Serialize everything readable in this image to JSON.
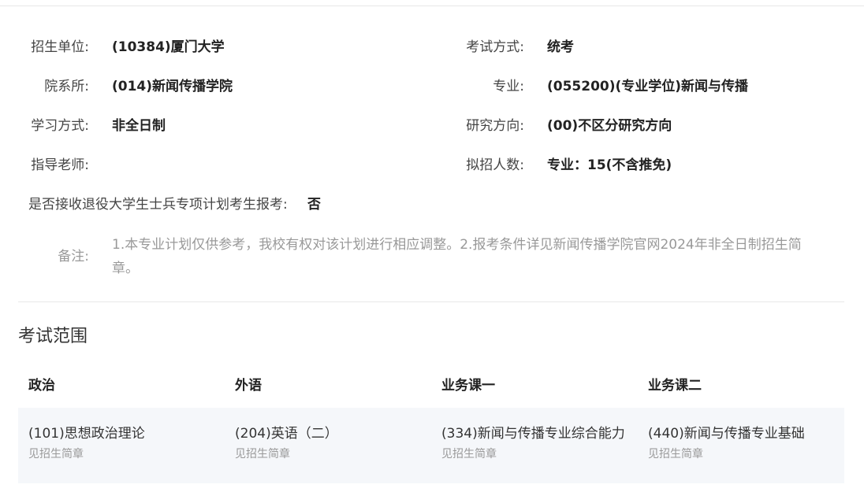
{
  "details": {
    "unit_label": "招生单位:",
    "unit_value": "(10384)厦门大学",
    "exam_method_label": "考试方式:",
    "exam_method_value": "统考",
    "dept_label": "院系所:",
    "dept_value": "(014)新闻传播学院",
    "major_label": "专业:",
    "major_value": "(055200)(专业学位)新闻与传播",
    "study_mode_label": "学习方式:",
    "study_mode_value": "非全日制",
    "research_label": "研究方向:",
    "research_value": "(00)不区分研究方向",
    "advisor_label": "指导老师:",
    "advisor_value": "",
    "quota_label": "拟招人数:",
    "quota_value": "专业：15(不含推免)",
    "veteran_label": "是否接收退役大学生士兵专项计划考生报考:",
    "veteran_value": "否",
    "note_label": "备注:",
    "note_value": "1.本专业计划仅供参考，我校有权对该计划进行相应调整。2.报考条件详见新闻传播学院官网2024年非全日制招生简章。"
  },
  "exam_scope": {
    "title": "考试范围",
    "headers": [
      "政治",
      "外语",
      "业务课一",
      "业务课二"
    ],
    "courses": [
      {
        "name": "(101)思想政治理论",
        "scope": "见招生简章"
      },
      {
        "name": "(204)英语（二）",
        "scope": "见招生简章"
      },
      {
        "name": "(334)新闻与传播专业综合能力",
        "scope": "见招生简章"
      },
      {
        "name": "(440)新闻与传播专业基础",
        "scope": "见招生简章"
      }
    ]
  }
}
